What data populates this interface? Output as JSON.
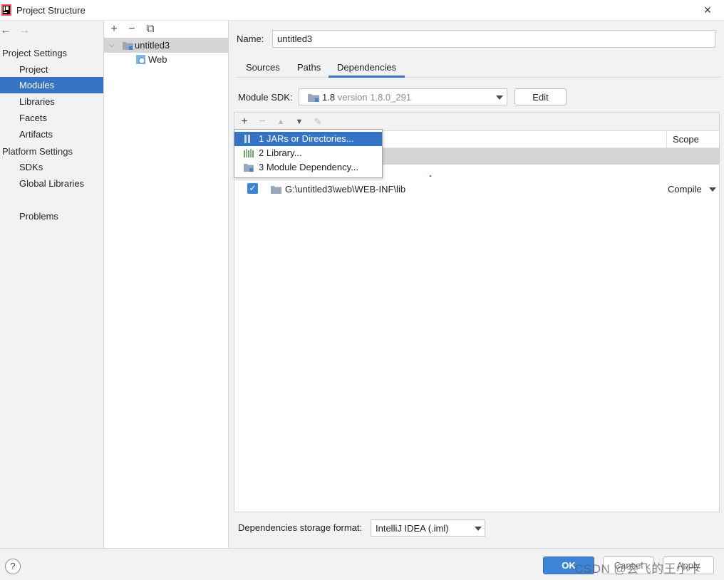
{
  "window": {
    "title": "Project Structure",
    "close_glyph": "×",
    "colors": {
      "accent": "#3574c5",
      "checkbox": "#3d84d6",
      "ok": "#3d84d6"
    }
  },
  "nav": {
    "back_glyph": "←",
    "forward_glyph": "→",
    "project_settings_label": "Project Settings",
    "project_items": [
      "Project",
      "Modules",
      "Libraries",
      "Facets",
      "Artifacts"
    ],
    "platform_settings_label": "Platform Settings",
    "platform_items": [
      "SDKs",
      "Global Libraries"
    ],
    "other_items": [
      "Problems"
    ],
    "active_item": "Modules"
  },
  "tree": {
    "toolbar": {
      "add": "+",
      "remove": "−",
      "copy": "⧉"
    },
    "chevron": "⌵",
    "root": "untitled3",
    "child": "Web"
  },
  "module": {
    "name_label": "Name:",
    "name_value": "untitled3",
    "tabs": [
      "Sources",
      "Paths",
      "Dependencies"
    ],
    "active_tab": "Dependencies",
    "sdk_label": "Module SDK:",
    "sdk_version": "1.8",
    "sdk_detail": "version 1.8.0_291",
    "edit_label": "Edit"
  },
  "dependencies": {
    "toolbar": {
      "add": "+",
      "remove": "−",
      "up": "▲",
      "down": "▼",
      "edit": "✎"
    },
    "scope_header": "Scope",
    "rows": [
      {
        "checked": true,
        "check_glyph": "✓",
        "path": "G:\\untitled3\\web\\WEB-INF\\lib",
        "scope": "Compile"
      }
    ]
  },
  "add_menu": {
    "items": [
      {
        "label": "1  JARs or Directories...",
        "icon": "jar-dir-icon"
      },
      {
        "label": "2  Library...",
        "icon": "library-icon"
      },
      {
        "label": "3  Module Dependency...",
        "icon": "module-icon"
      }
    ],
    "highlighted_index": 0
  },
  "storage": {
    "label": "Dependencies storage format:",
    "value": "IntelliJ IDEA (.iml)"
  },
  "footer": {
    "help": "?",
    "ok": "OK",
    "cancel": "Cancel",
    "apply": "Apply",
    "watermark": "CSDN @会飞的王小卡"
  }
}
